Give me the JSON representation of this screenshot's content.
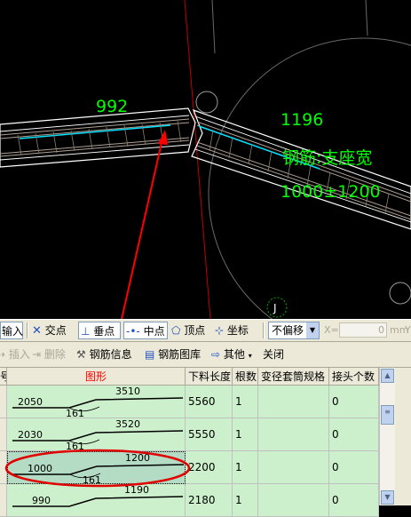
{
  "cad": {
    "labels": {
      "len_left": "992",
      "len_right": "1196",
      "cn_name": "钢筋:支座宽",
      "range": "1000±1200"
    },
    "view_marker": "J",
    "colors": {
      "background": "#000000",
      "dim_text": "#00ff00",
      "beam_lines": "#ffffff",
      "center_line": "#00ffff",
      "rebar": "#b0a090",
      "arrow": "#ff0000",
      "cursor_line": "#c00000"
    }
  },
  "snap_toolbar": {
    "input": "输入",
    "intersection": "交点",
    "perpendicular": "垂点",
    "midpoint": "中点",
    "vertex": "顶点",
    "coordinate": "坐标",
    "offset_mode": "不偏移",
    "x_label": "X=",
    "x_value": "0",
    "unit": "mm",
    "y_label": "Y"
  },
  "rebar_toolbar": {
    "insert": "插入",
    "delete": "删除",
    "rebar_info": "钢筋信息",
    "rebar_library": "钢筋图库",
    "other": "其他",
    "close": "关闭"
  },
  "grid": {
    "headers": {
      "no": "号",
      "shape": "图形",
      "cut_length": "下料长度",
      "count": "根数",
      "sleeve_spec": "变径套筒规格",
      "joint_count": "接头个数"
    },
    "rows": [
      {
        "left": "2050",
        "right": "3510",
        "angle": "161",
        "cut_length": "5560",
        "count": "1",
        "sleeve": "",
        "joints": "0"
      },
      {
        "left": "2030",
        "right": "3520",
        "angle": "161",
        "cut_length": "5550",
        "count": "1",
        "sleeve": "",
        "joints": "0"
      },
      {
        "left": "1000",
        "right": "1200",
        "angle": "161",
        "cut_length": "2200",
        "count": "1",
        "sleeve": "",
        "joints": "0"
      },
      {
        "left": "990",
        "right": "1190",
        "angle": "",
        "cut_length": "2180",
        "count": "1",
        "sleeve": "",
        "joints": "0"
      }
    ],
    "colors": {
      "row_bg": "#ccf0cc",
      "selected_bg": "#b4dcc4",
      "highlight_ellipse": "#e00000",
      "header_shape_text": "#ff0000"
    }
  }
}
